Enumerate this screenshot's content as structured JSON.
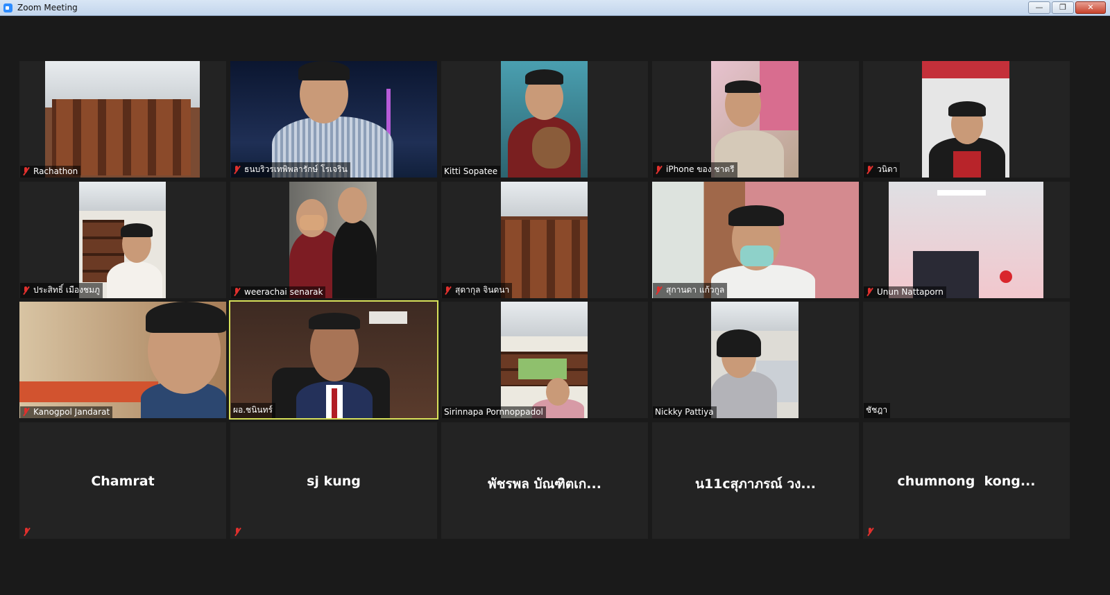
{
  "window": {
    "title": "Zoom Meeting"
  },
  "participants": [
    {
      "name": "Rachathon",
      "muted": true
    },
    {
      "name": "ธนบริวรเทพิพลารักษ์ โรเจริน",
      "muted": true
    },
    {
      "name": "Kitti Sopatee",
      "muted": false
    },
    {
      "name": "iPhone ของ ชาตรี",
      "muted": true
    },
    {
      "name": "วนิดา",
      "muted": true
    },
    {
      "name": "ประสิทธิ์ เมืองชมภู",
      "muted": true
    },
    {
      "name": "weerachai senarak",
      "muted": true
    },
    {
      "name": "สุดากุล จินดนา",
      "muted": true
    },
    {
      "name": "สุกานดา แก้วกูล",
      "muted": true
    },
    {
      "name": "Unun Nattaporn",
      "muted": true
    },
    {
      "name": "Kanogpol Jandarat",
      "muted": true
    },
    {
      "name": "ผอ.ชนินทร์",
      "muted": false,
      "active_speaker": true
    },
    {
      "name": "Sirinnapa Pornnoppadol",
      "muted": false
    },
    {
      "name": "Nickky Pattiya",
      "muted": false
    },
    {
      "name": "ชัชฎา",
      "muted": false
    },
    {
      "name": "Chamrat",
      "muted": true,
      "video_off": true
    },
    {
      "name": "sj kung",
      "muted": true,
      "video_off": true
    },
    {
      "name": "พัชรพล บัณฑิตเก...",
      "muted": false,
      "video_off": true
    },
    {
      "name": "น11cสุภาภรณ์ วง...",
      "muted": false,
      "video_off": true
    },
    {
      "name": "chumnong  kong...",
      "muted": true,
      "video_off": true
    }
  ],
  "colors": {
    "active_speaker_border": "#d8e15a",
    "muted_mic": "#e0302d",
    "background": "#1a1a1a"
  }
}
